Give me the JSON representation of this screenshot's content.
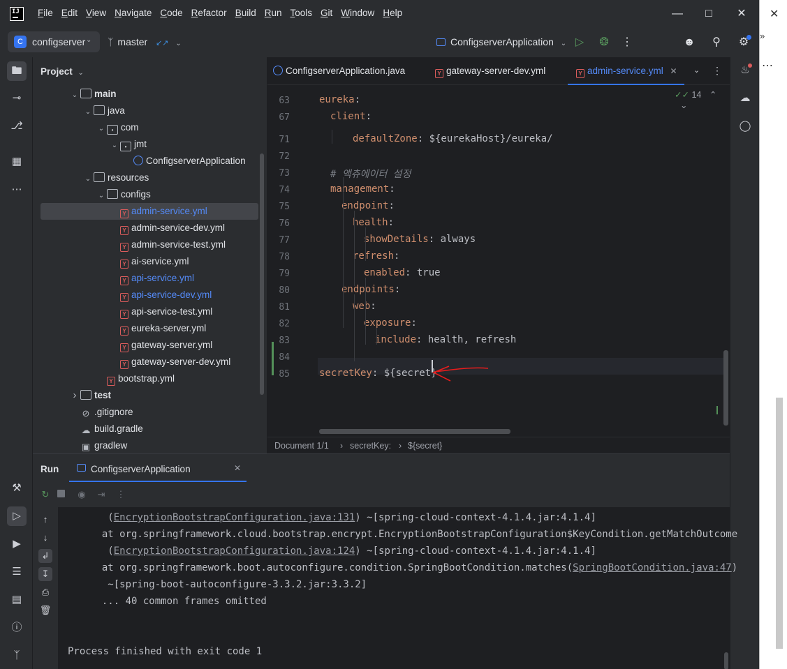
{
  "menu": {
    "items": [
      "File",
      "Edit",
      "View",
      "Navigate",
      "Code",
      "Refactor",
      "Build",
      "Run",
      "Tools",
      "Git",
      "Window",
      "Help"
    ]
  },
  "toolbar": {
    "project_badge": "C",
    "project_name": "configserver",
    "branch": "master",
    "run_config": "ConfigserverApplication"
  },
  "project_panel": {
    "title": "Project",
    "tree": [
      {
        "label": "main",
        "icon": "folder-icon",
        "bold": true
      },
      {
        "label": "java",
        "icon": "folder-icon"
      },
      {
        "label": "com",
        "icon": "package-icon"
      },
      {
        "label": "jmt",
        "icon": "package-icon"
      },
      {
        "label": "ConfigserverApplication",
        "icon": "spring-class-icon"
      },
      {
        "label": "resources",
        "icon": "folder-icon"
      },
      {
        "label": "configs",
        "icon": "folder-icon"
      },
      {
        "label": "admin-service.yml",
        "icon": "yml-icon",
        "selected": true,
        "blue": true
      },
      {
        "label": "admin-service-dev.yml",
        "icon": "yml-icon"
      },
      {
        "label": "admin-service-test.yml",
        "icon": "yml-icon"
      },
      {
        "label": "ai-service.yml",
        "icon": "yml-icon"
      },
      {
        "label": "api-service.yml",
        "icon": "yml-icon",
        "blue": true
      },
      {
        "label": "api-service-dev.yml",
        "icon": "yml-icon",
        "blue": true
      },
      {
        "label": "api-service-test.yml",
        "icon": "yml-icon"
      },
      {
        "label": "eureka-server.yml",
        "icon": "yml-icon"
      },
      {
        "label": "gateway-server.yml",
        "icon": "yml-icon"
      },
      {
        "label": "gateway-server-dev.yml",
        "icon": "yml-icon"
      },
      {
        "label": "bootstrap.yml",
        "icon": "yml-icon"
      },
      {
        "label": "test",
        "icon": "folder-icon",
        "bold": true
      },
      {
        "label": ".gitignore",
        "icon": "ignore-icon"
      },
      {
        "label": "build.gradle",
        "icon": "gradle-icon"
      },
      {
        "label": "gradlew",
        "icon": "terminal-file-icon"
      }
    ]
  },
  "editor": {
    "tabs": [
      {
        "label": "ConfigserverApplication.java"
      },
      {
        "label": "gateway-server-dev.yml"
      },
      {
        "label": "admin-service.yml",
        "active": true
      }
    ],
    "inspection_count": "14",
    "lines": [
      {
        "n": "63",
        "key": "eureka",
        "rest": ":"
      },
      {
        "n": "67",
        "key": "client",
        "rest": ":"
      },
      {
        "n": "71",
        "key": "defaultZone",
        "rest": ": ${eurekaHost}/eureka/"
      },
      {
        "n": "72",
        "key": "",
        "rest": ""
      },
      {
        "n": "73",
        "comment": "# 액츄에이터 설정"
      },
      {
        "n": "74",
        "key": "management",
        "rest": ":"
      },
      {
        "n": "75",
        "key": "endpoint",
        "rest": ":"
      },
      {
        "n": "76",
        "key": "health",
        "rest": ":"
      },
      {
        "n": "77",
        "key": "showDetails",
        "rest": ": always"
      },
      {
        "n": "78",
        "key": "refresh",
        "rest": ":"
      },
      {
        "n": "79",
        "key": "enabled",
        "rest": ": true"
      },
      {
        "n": "80",
        "key": "endpoints",
        "rest": ":"
      },
      {
        "n": "81",
        "key": "web",
        "rest": ":"
      },
      {
        "n": "82",
        "key": "exposure",
        "rest": ":"
      },
      {
        "n": "83",
        "key": "include",
        "rest": ": health, refresh"
      },
      {
        "n": "84",
        "key": "",
        "rest": ""
      },
      {
        "n": "85",
        "key": "secretKey",
        "rest": ": ${secret}"
      }
    ],
    "breadcrumb": [
      "Document 1/1",
      "secretKey:",
      "${secret}"
    ]
  },
  "run_panel": {
    "title": "Run",
    "tab_label": "ConfigserverApplication",
    "console": [
      {
        "link": "EncryptionBootstrapConfiguration.java:131",
        "prefix": "   (",
        "suffix": ") ~[spring-cloud-context-4.1.4.jar:4.1.4]"
      },
      {
        "text": "  at org.springframework.cloud.bootstrap.encrypt.EncryptionBootstrapConfiguration$KeyCondition.getMatchOutcome"
      },
      {
        "link": "EncryptionBootstrapConfiguration.java:124",
        "prefix": "   (",
        "suffix": ") ~[spring-cloud-context-4.1.4.jar:4.1.4]"
      },
      {
        "text": "  at org.springframework.boot.autoconfigure.condition.SpringBootCondition.matches(",
        "link2": "SpringBootCondition.java:47",
        "suffix2": ")"
      },
      {
        "text": "   ~[spring-boot-autoconfigure-3.3.2.jar:3.3.2]"
      },
      {
        "text": "  ... 40 common frames omitted"
      },
      {
        "text": ""
      },
      {
        "text": ""
      },
      {
        "text": "Process finished with exit code 1"
      }
    ]
  },
  "colors": {
    "accent": "#3574f0",
    "yaml_key": "#cf8e6d",
    "annotation_arrow": "#e81c1c"
  }
}
